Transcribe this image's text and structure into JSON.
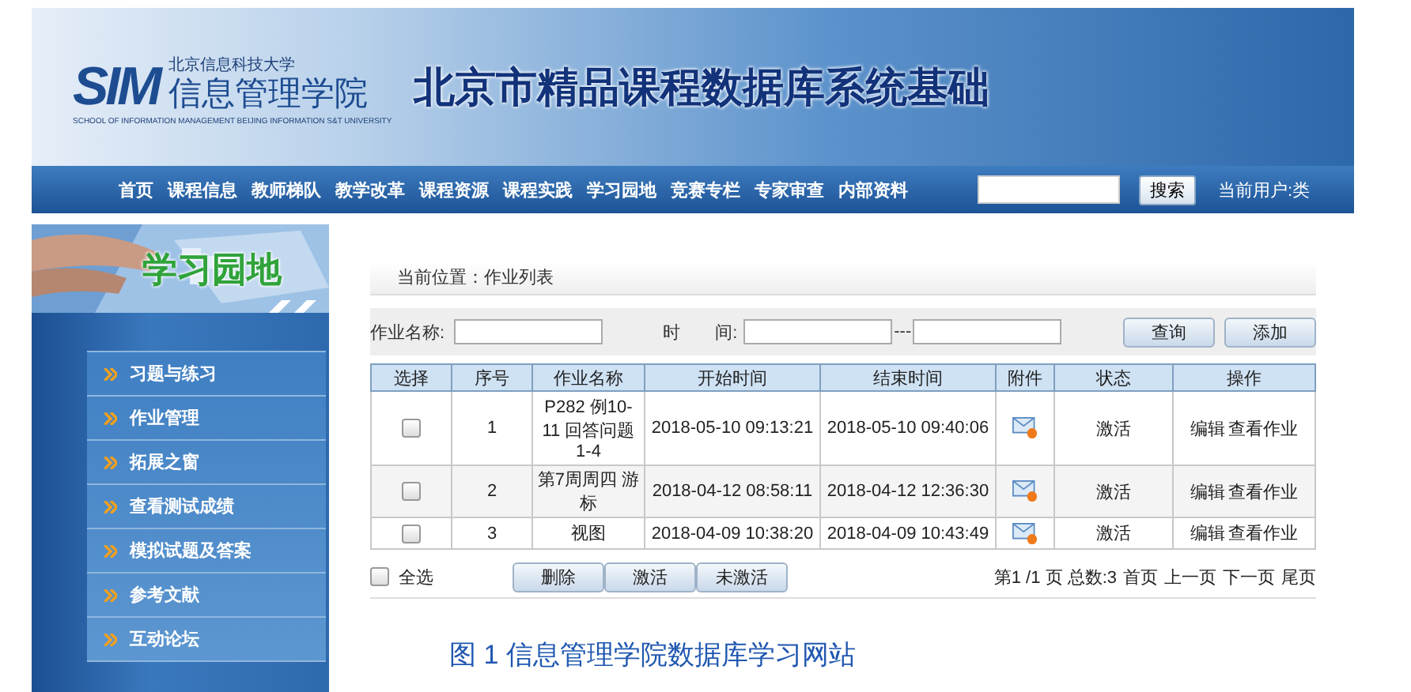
{
  "header": {
    "university": "北京信息科技大学",
    "logo": "SIM",
    "school": "信息管理学院",
    "school_en": "SCHOOL OF INFORMATION MANAGEMENT BEIJING INFORMATION S&T UNIVERSITY",
    "title": "北京市精品课程数据库系统基础"
  },
  "nav": {
    "items": [
      "首页",
      "课程信息",
      "教师梯队",
      "教学改革",
      "课程资源",
      "课程实践",
      "学习园地",
      "竞赛专栏",
      "专家审查",
      "内部资料"
    ],
    "search_button": "搜索",
    "user": "当前用户:类"
  },
  "sidebar": {
    "title": "学习园地",
    "items": [
      {
        "label": "习题与练习"
      },
      {
        "label": "作业管理"
      },
      {
        "label": "拓展之窗"
      },
      {
        "label": "查看测试成绩"
      },
      {
        "label": "模拟试题及答案"
      },
      {
        "label": "参考文献"
      },
      {
        "label": "互动论坛"
      }
    ]
  },
  "breadcrumb": "当前位置：作业列表",
  "filter": {
    "name_label": "作业名称:",
    "time_label": "时　　间:",
    "range_separator": "---",
    "buttons": [
      "查询",
      "添加"
    ]
  },
  "table": {
    "columns": [
      "选择",
      "序号",
      "作业名称",
      "开始时间",
      "结束时间",
      "附件",
      "状态",
      "操作"
    ],
    "rows": [
      {
        "checked": false,
        "no": "1",
        "name": "P282 例10-11 回答问题1-4",
        "start": "2018-05-10 09:13:21",
        "end": "2018-05-10 09:40:06",
        "status": "激活",
        "actions": [
          "编辑",
          "查看作业"
        ]
      },
      {
        "checked": false,
        "no": "2",
        "name": "第7周周四 游标",
        "start": "2018-04-12 08:58:11",
        "end": "2018-04-12 12:36:30",
        "status": "激活",
        "actions": [
          "编辑",
          "查看作业"
        ]
      },
      {
        "checked": false,
        "no": "3",
        "name": "视图",
        "start": "2018-04-09 10:38:20",
        "end": "2018-04-09 10:43:49",
        "status": "激活",
        "actions": [
          "编辑",
          "查看作业"
        ]
      }
    ]
  },
  "footer": {
    "select_all": {
      "label": "全选",
      "checked": false
    },
    "buttons": [
      "删除",
      "激活",
      "未激活"
    ],
    "page_info": "第1 /1 页 总数:3",
    "page_links": [
      "首页",
      "上一页",
      "下一页",
      "尾页"
    ]
  },
  "caption": "图 1  信息管理学院数据库学习网站"
}
